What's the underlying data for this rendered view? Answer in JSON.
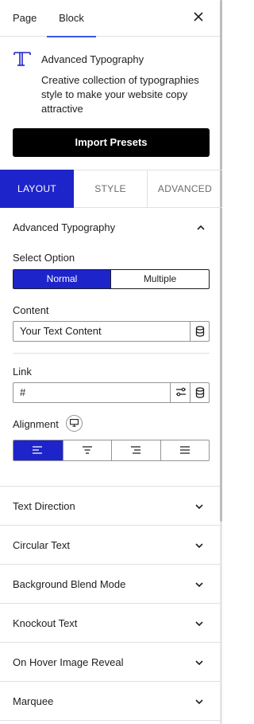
{
  "header": {
    "tabs": [
      {
        "label": "Page",
        "active": false
      },
      {
        "label": "Block",
        "active": true
      }
    ],
    "close_icon": "close-icon",
    "accent_color": "#3858e9"
  },
  "block_card": {
    "icon": "typography-icon",
    "title": "Advanced Typography",
    "description": "Creative collection of typographies style to make your website copy attractive"
  },
  "import_button": {
    "label": "Import Presets"
  },
  "panel_tabs": [
    {
      "label": "LAYOUT",
      "active": true
    },
    {
      "label": "STYLE",
      "active": false
    },
    {
      "label": "ADVANCED",
      "active": false
    }
  ],
  "active_color": "#1d24c9",
  "main_section": {
    "title": "Advanced Typography",
    "expanded": true,
    "select_option": {
      "label": "Select Option",
      "options": [
        "Normal",
        "Multiple"
      ],
      "selected": "Normal"
    },
    "content": {
      "label": "Content",
      "value": "Your Text Content",
      "dynamic_icon": "database-icon"
    },
    "link": {
      "label": "Link",
      "value": "#",
      "settings_icon": "link-settings-icon",
      "dynamic_icon": "database-icon"
    },
    "alignment": {
      "label": "Alignment",
      "device_icon": "desktop-icon",
      "options": [
        "align-left-icon",
        "align-center-icon",
        "align-right-icon",
        "align-justify-icon"
      ],
      "selected": "align-left-icon"
    }
  },
  "accordions": [
    {
      "title": "Text Direction"
    },
    {
      "title": "Circular Text"
    },
    {
      "title": "Background Blend Mode"
    },
    {
      "title": "Knockout Text"
    },
    {
      "title": "On Hover Image Reveal"
    },
    {
      "title": "Marquee"
    }
  ]
}
